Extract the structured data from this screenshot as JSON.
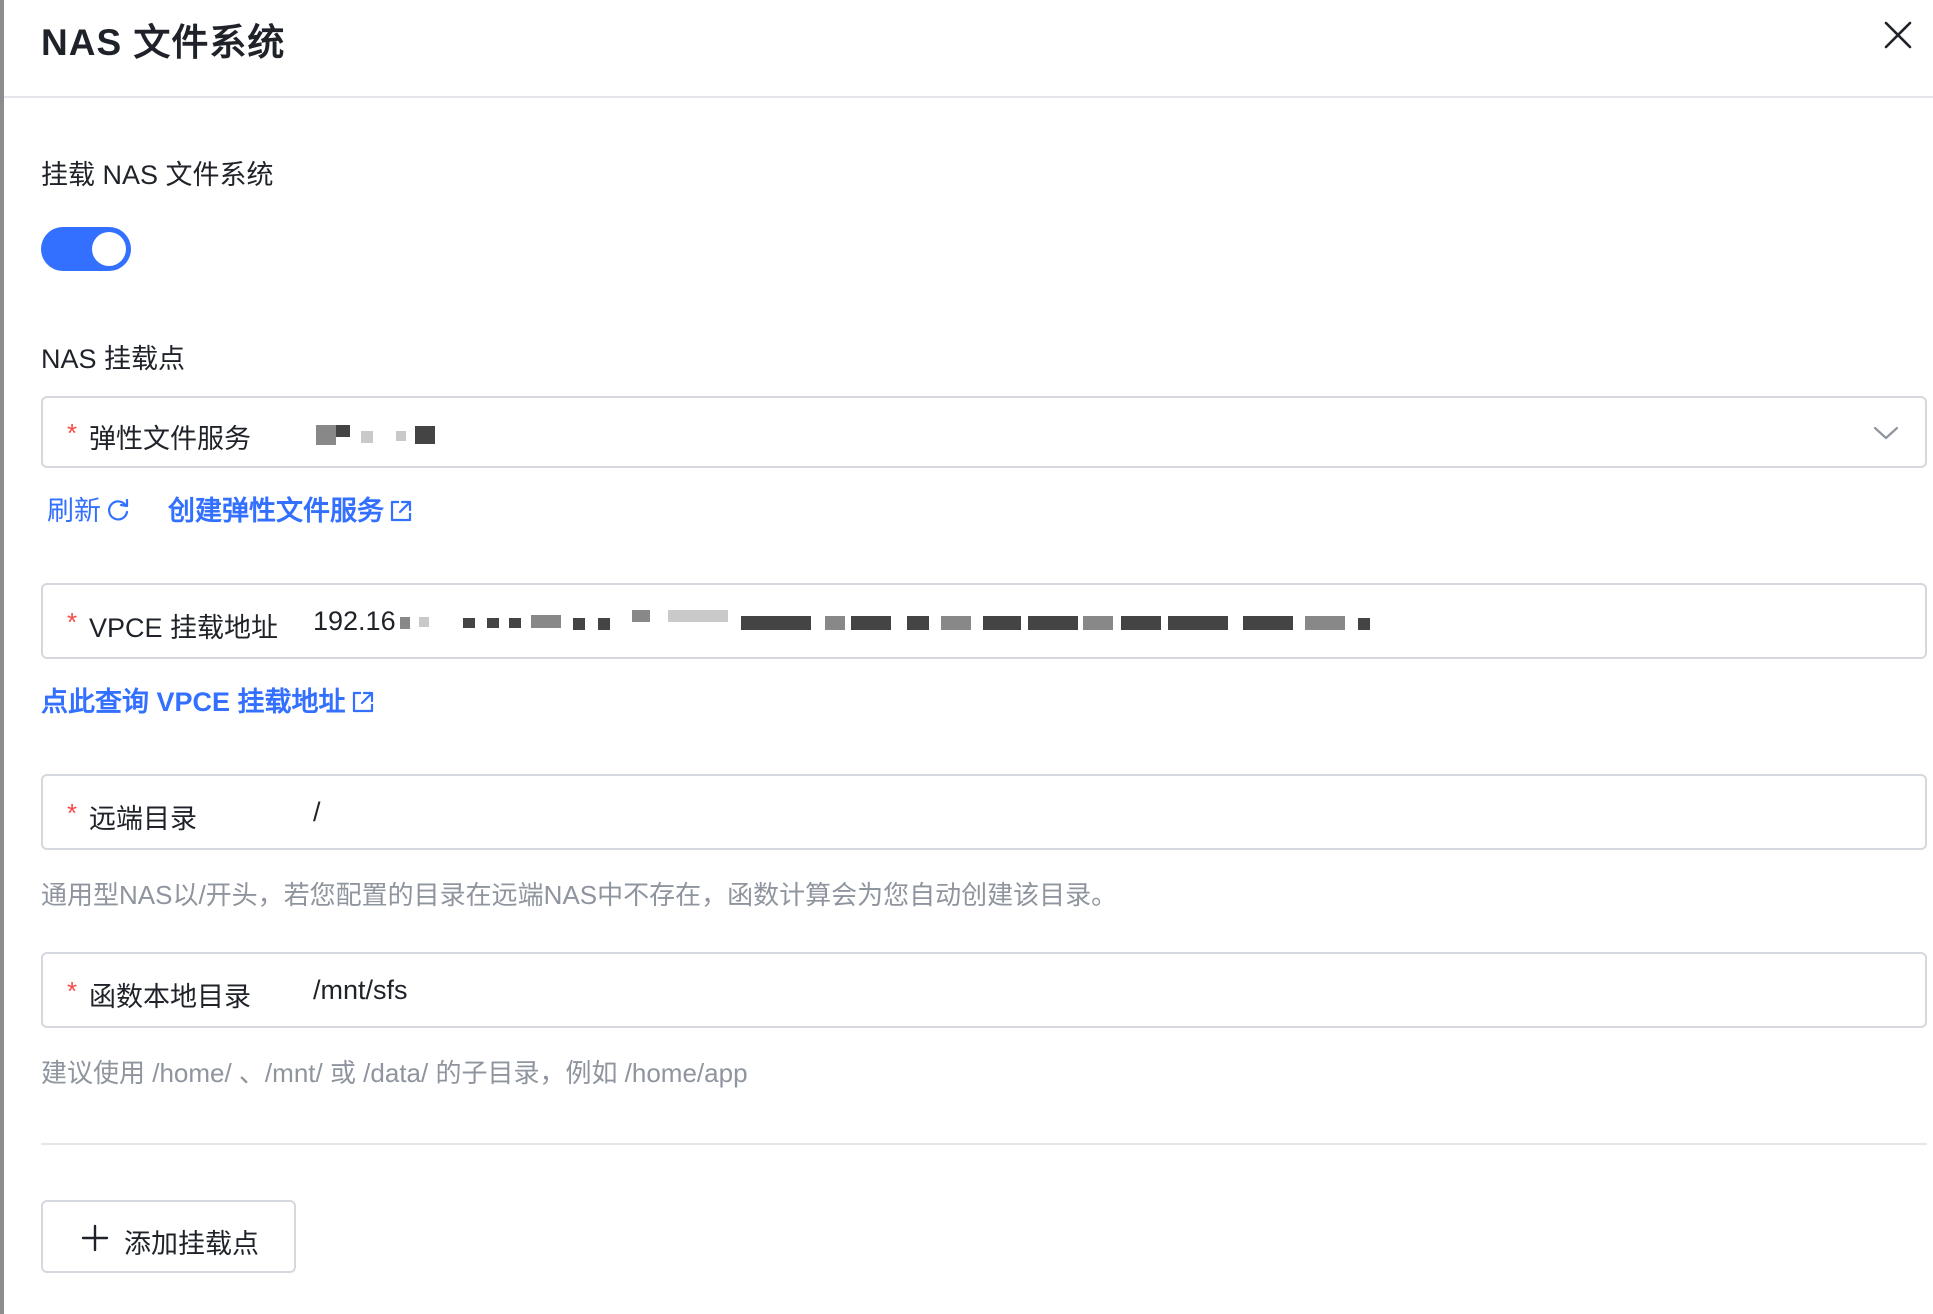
{
  "header": {
    "title": "NAS 文件系统"
  },
  "mount_section": {
    "label": "挂载 NAS 文件系统",
    "enabled": true
  },
  "mount_point_label": "NAS 挂载点",
  "efs_field": {
    "label": "弹性文件服务"
  },
  "efs_links": {
    "refresh": "刷新",
    "create": "创建弹性文件服务"
  },
  "vpce_field": {
    "label": "VPCE 挂载地址",
    "value": "192.16"
  },
  "vpce_link": "点此查询 VPCE 挂载地址",
  "remote_dir_field": {
    "label": "远端目录",
    "value": "/"
  },
  "remote_dir_hint": "通用型NAS以/开头，若您配置的目录在远端NAS中不存在，函数计算会为您自动创建该目录。",
  "local_dir_field": {
    "label": "函数本地目录",
    "value": "/mnt/sfs"
  },
  "local_dir_hint": "建议使用 /home/ 、/mnt/ 或 /data/ 的子目录，例如 /home/app",
  "add_button": {
    "label": "添加挂载点"
  },
  "colors": {
    "accent": "#3370ff",
    "required": "#f54a45",
    "hint": "#8f959e"
  }
}
